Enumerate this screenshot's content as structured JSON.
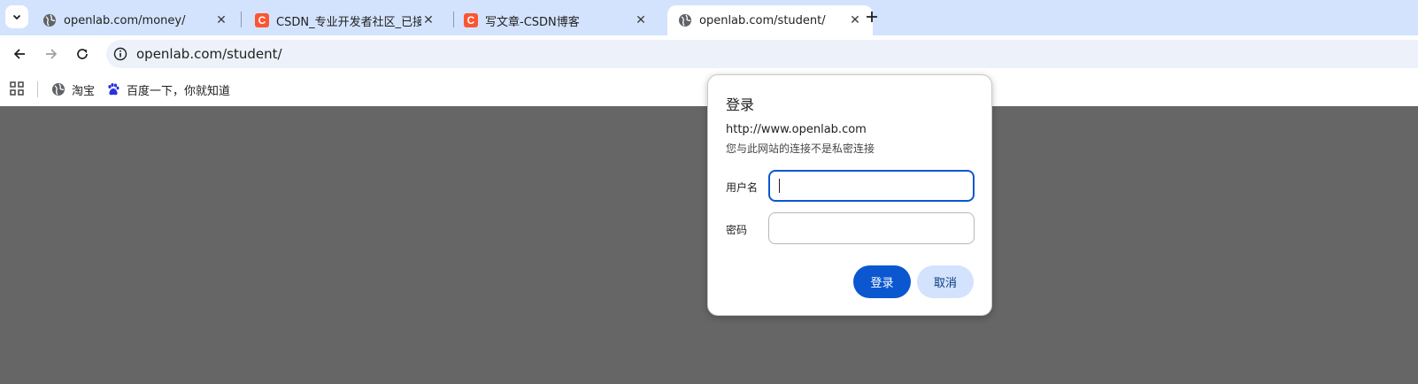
{
  "tabs": [
    {
      "title": "openlab.com/money/",
      "favicon": "globe-icon",
      "active": false
    },
    {
      "title": "CSDN_专业开发者社区_已接入",
      "favicon": "csdn-logo-icon",
      "active": false
    },
    {
      "title": "写文章-CSDN博客",
      "favicon": "csdn-logo-icon",
      "active": false
    },
    {
      "title": "openlab.com/student/",
      "favicon": "globe-icon",
      "active": true
    }
  ],
  "csdn_logo_letter": "C",
  "address_bar": {
    "url": "openlab.com/student/"
  },
  "bookmarks": [
    {
      "label": "淘宝",
      "icon": "globe-icon"
    },
    {
      "label": "百度一下，你就知道",
      "icon": "baidu-paw-icon"
    }
  ],
  "auth_dialog": {
    "title": "登录",
    "host": "http://www.openlab.com",
    "warning": "您与此网站的连接不是私密连接",
    "username_label": "用户名",
    "username_value": "",
    "password_label": "密码",
    "password_value": "",
    "sign_in_label": "登录",
    "cancel_label": "取消"
  },
  "colors": {
    "tabstrip": "#d3e3fd",
    "page_overlay": "#666666",
    "primary_button": "#0b57d0",
    "secondary_button": "#d3e3fd",
    "csdn_red": "#fc5531"
  }
}
